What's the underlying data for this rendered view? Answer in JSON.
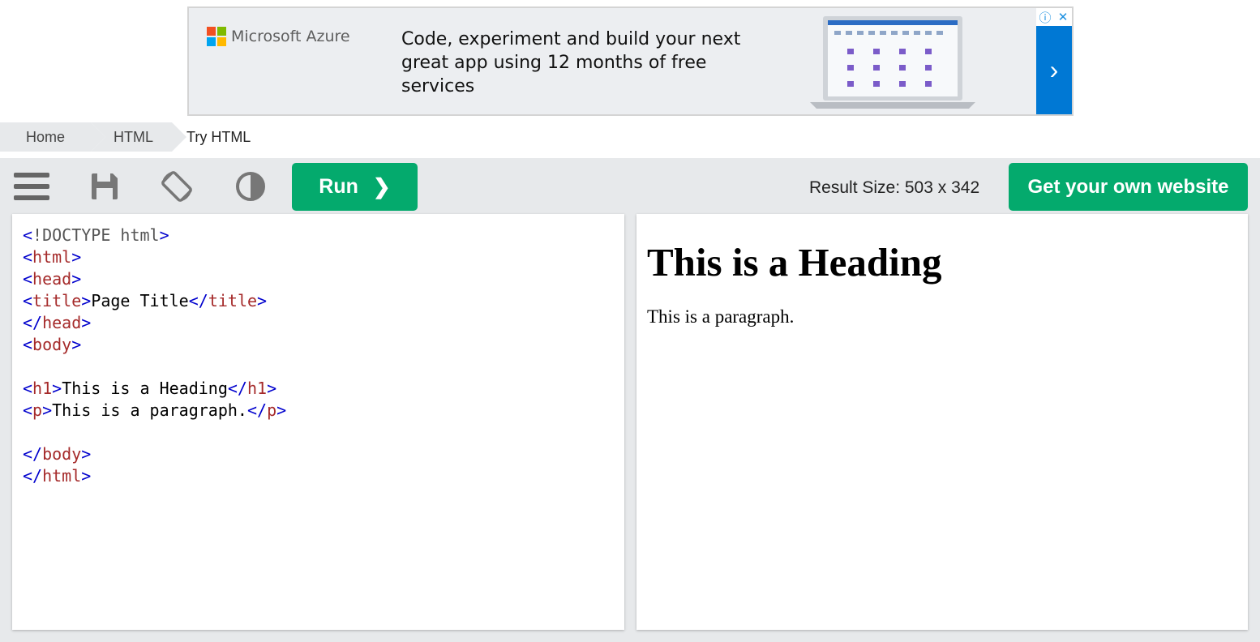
{
  "ad": {
    "brand": "Microsoft Azure",
    "headline": "Code, experiment and build your next great app using 12 months of free services",
    "info_icon": "ⓘ",
    "close_icon": "✕",
    "arrow_icon": "›",
    "colors": {
      "arrow_bg": "#0078d4",
      "ms_red": "#f25022",
      "ms_green": "#7fba00",
      "ms_blue": "#00a4ef",
      "ms_yellow": "#ffb900"
    }
  },
  "breadcrumb": {
    "items": [
      "Home",
      "HTML",
      "Try HTML"
    ]
  },
  "toolbar": {
    "icons": [
      "menu-icon",
      "save-icon",
      "rotate-icon",
      "contrast-icon"
    ],
    "run_label": "Run",
    "run_chevron": "❯",
    "result_size": "Result Size: 503 x 342",
    "own_site_label": "Get your own website",
    "accent": "#04aa6d"
  },
  "editor": {
    "lines": [
      "<!DOCTYPE html>",
      "<html>",
      "<head>",
      "<title>Page Title</title>",
      "</head>",
      "<body>",
      "",
      "<h1>This is a Heading</h1>",
      "<p>This is a paragraph.</p>",
      "",
      "</body>",
      "</html>"
    ]
  },
  "result": {
    "heading": "This is a Heading",
    "paragraph": "This is a paragraph."
  }
}
